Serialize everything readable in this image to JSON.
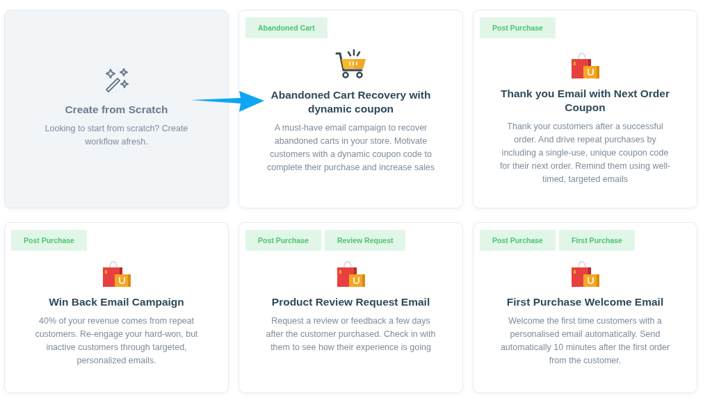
{
  "cards": [
    {
      "kind": "scratch",
      "title": "Create from Scratch",
      "description": "Looking to start from scratch? Create workflow afresh."
    },
    {
      "kind": "cart",
      "tags": [
        "Abandoned Cart"
      ],
      "title": "Abandoned Cart Recovery with dynamic coupon",
      "description": "A must-have email campaign to recover abandoned carts in your store. Motivate customers with a dynamic coupon code to complete their purchase and increase sales"
    },
    {
      "kind": "bags",
      "tags": [
        "Post Purchase"
      ],
      "title": "Thank you Email with Next Order Coupon",
      "description": "Thank your customers after a successful order. And drive repeat purchases by including a single-use, unique coupon code for their next order. Remind them using well-timed, targeted emails"
    },
    {
      "kind": "bags",
      "tags": [
        "Post Purchase"
      ],
      "title": "Win Back Email Campaign",
      "description": "40% of your revenue comes from repeat customers. Re-engage your hard-won, but inactive customers through targeted, personalized emails."
    },
    {
      "kind": "bags",
      "tags": [
        "Post Purchase",
        "Review Request"
      ],
      "title": "Product Review Request Email",
      "description": "Request a review or feedback a few days after the customer purchased. Check in with them to see how their experience is going"
    },
    {
      "kind": "bags",
      "tags": [
        "Post Purchase",
        "First Purchase"
      ],
      "title": "First Purchase Welcome Email",
      "description": "Welcome the first time customers with a personalised email automatically. Send automatically 10 minutes after the first order from the customer."
    }
  ]
}
